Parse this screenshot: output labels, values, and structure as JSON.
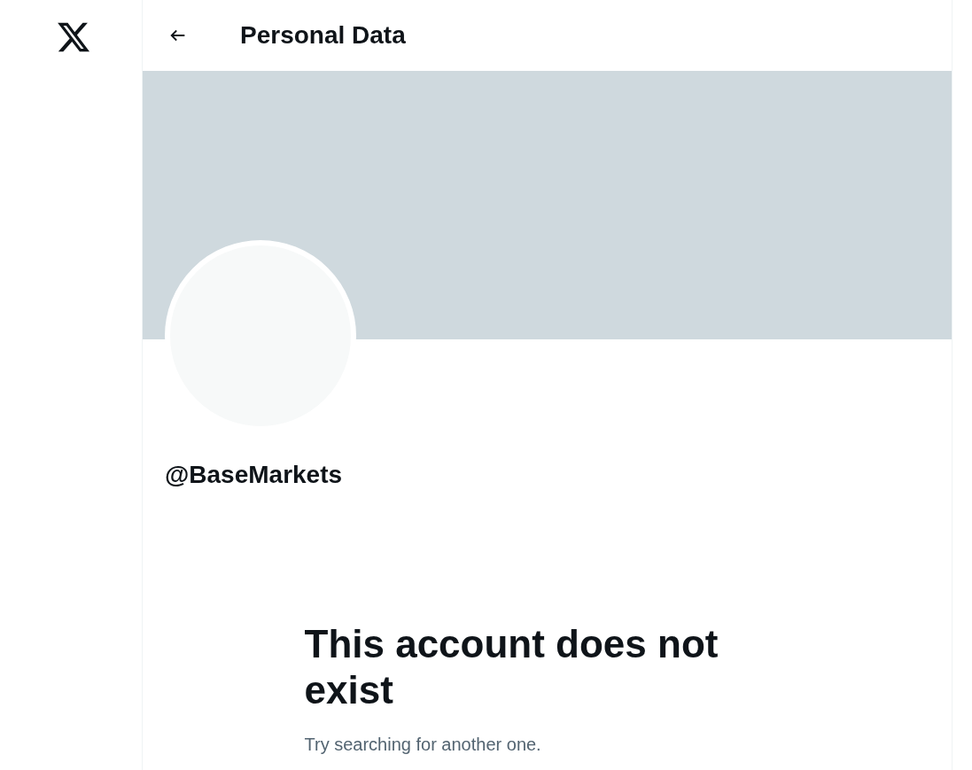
{
  "header": {
    "title": "Personal Data"
  },
  "profile": {
    "handle": "@BaseMarkets"
  },
  "empty_state": {
    "heading": "This account does not exist",
    "message": "Try searching for another one."
  }
}
